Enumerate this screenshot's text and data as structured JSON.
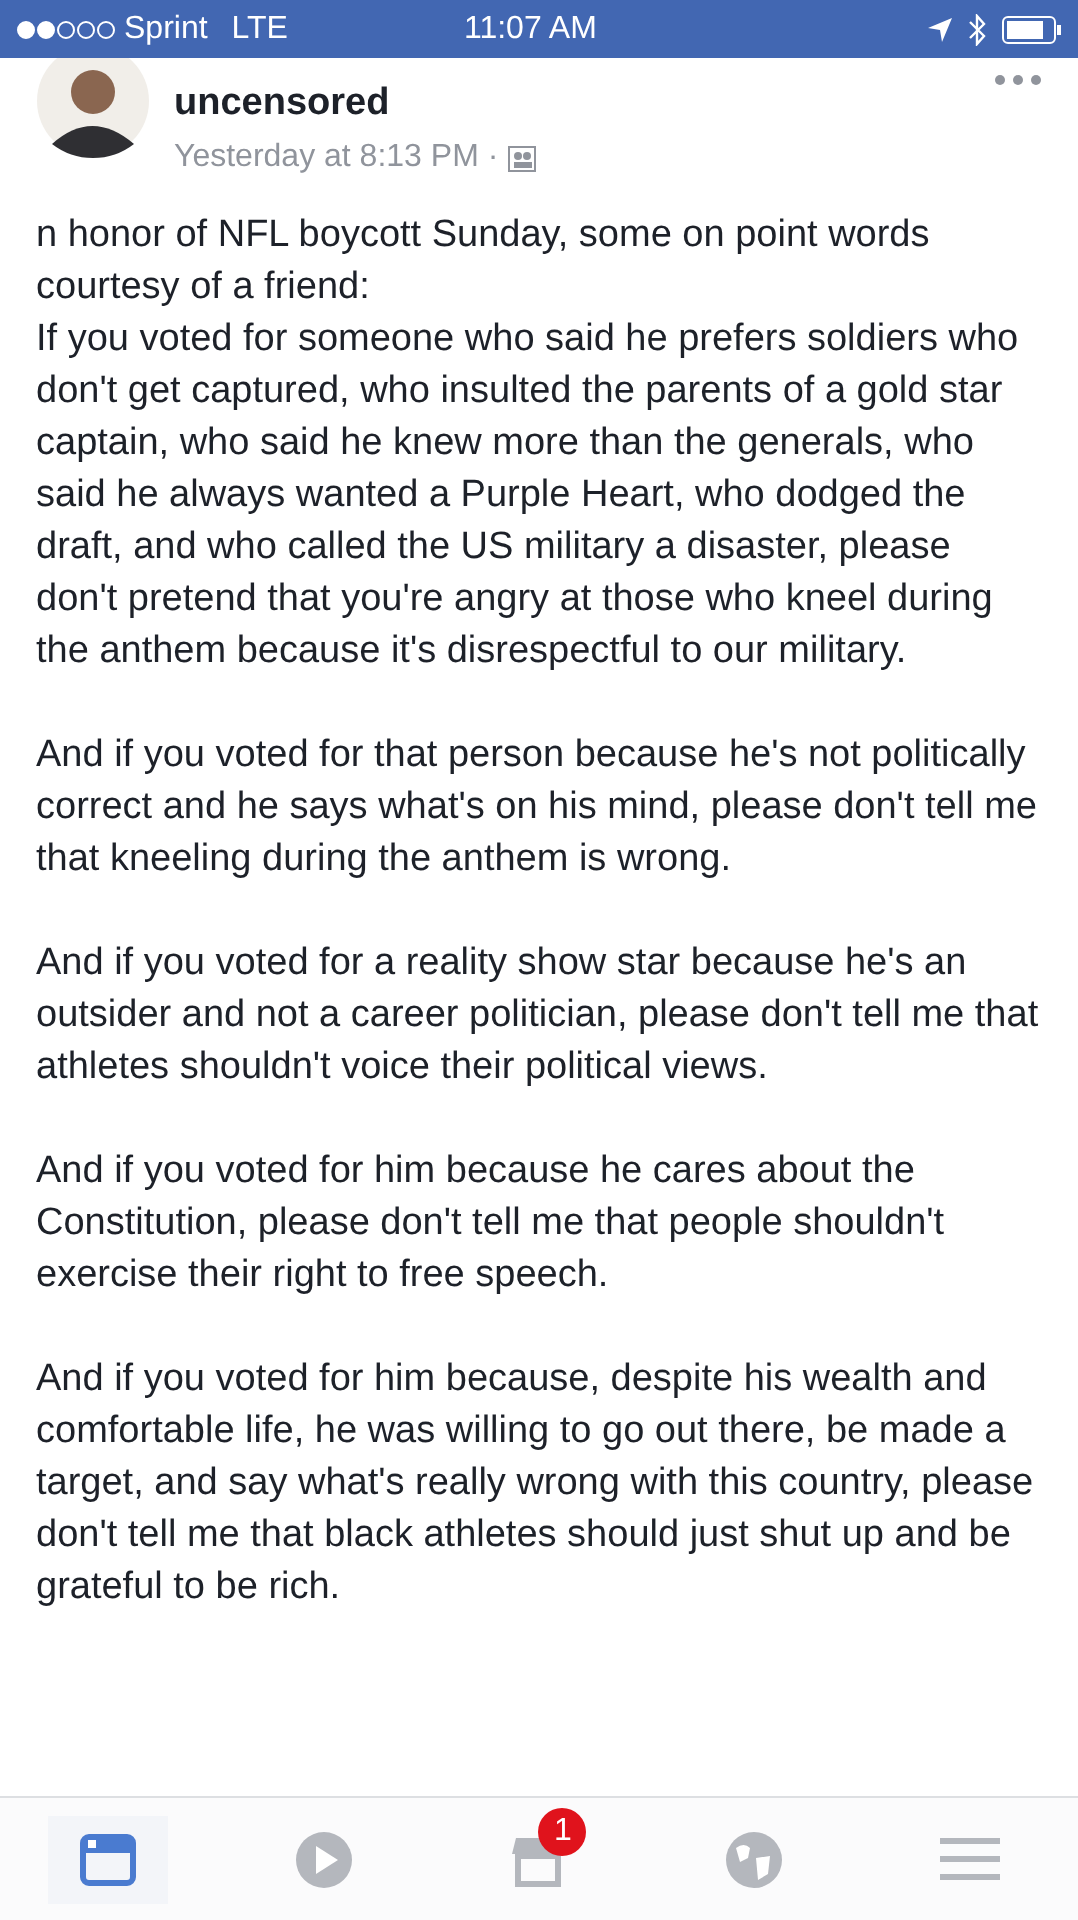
{
  "status_bar": {
    "carrier": "Sprint",
    "network": "LTE",
    "time": "11:07 AM"
  },
  "post": {
    "group_continued": "uncensored",
    "timestamp": "Yesterday at 8:13 PM ·",
    "paragraphs": [
      "n honor of NFL boycott Sunday, some on point words courtesy of a friend:\nIf you voted for someone who said he prefers soldiers who don't get captured, who insulted the parents of a gold star captain, who said he knew more than the generals, who said he always wanted a Purple Heart, who dodged the draft, and who called the US military a disaster, please don't pretend that you're angry at those who kneel during the anthem because it's disrespectful to our military.",
      "And if you voted for that person because he's not politically correct and he says what's on his mind, please don't tell me that kneeling during the anthem is wrong.",
      "And if you voted for a reality show star because he's an outsider and not a career politician, please don't tell me that athletes shouldn't voice their political views.",
      "And if you voted for him because he cares about the Constitution, please don't tell me that people shouldn't exercise their right to free speech.",
      "And if you voted for him because, despite his wealth and comfortable life, he was willing to go out there, be made a target, and say what's really wrong with this country, please don't tell me that black athletes should just shut up and be grateful to be rich."
    ]
  },
  "tab_bar": [
    {
      "kind": "news",
      "selected": true
    },
    {
      "kind": "video",
      "selected": false
    },
    {
      "kind": "market",
      "selected": false,
      "badge": "1"
    },
    {
      "kind": "globe",
      "selected": false
    },
    {
      "kind": "menu",
      "selected": false
    }
  ]
}
